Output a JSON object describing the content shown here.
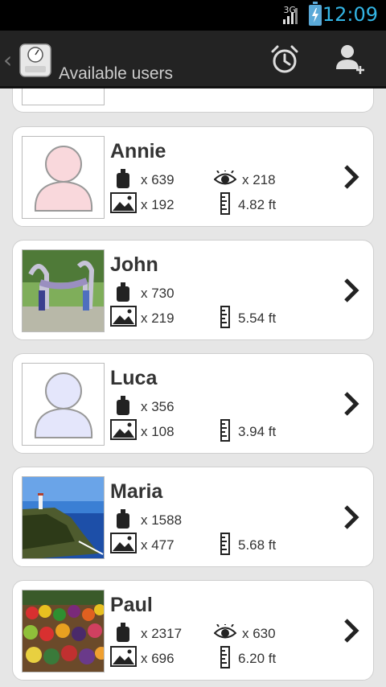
{
  "status_bar": {
    "network": "3G",
    "time": "12:09",
    "accent": "#33b5e5"
  },
  "action_bar": {
    "title": "Available users",
    "icons": [
      "scale-logo-icon",
      "alarm-clock-icon",
      "add-user-icon"
    ]
  },
  "users": [
    {
      "name": "Annie",
      "weighings": "x 639",
      "views": "x 218",
      "photos": "x 192",
      "height": "4.82 ft",
      "avatar": "pink-person-placeholder"
    },
    {
      "name": "John",
      "weighings": "x 730",
      "photos": "x 219",
      "height": "5.54 ft",
      "avatar": "sculpture-photo"
    },
    {
      "name": "Luca",
      "weighings": "x 356",
      "photos": "x 108",
      "height": "3.94 ft",
      "avatar": "blue-person-placeholder"
    },
    {
      "name": "Maria",
      "weighings": "x 1588",
      "photos": "x 477",
      "height": "5.68 ft",
      "avatar": "coastal-lighthouse-photo"
    },
    {
      "name": "Paul",
      "weighings": "x 2317",
      "views": "x 630",
      "photos": "x 696",
      "height": "6.20 ft",
      "avatar": "fruit-market-photo"
    }
  ]
}
